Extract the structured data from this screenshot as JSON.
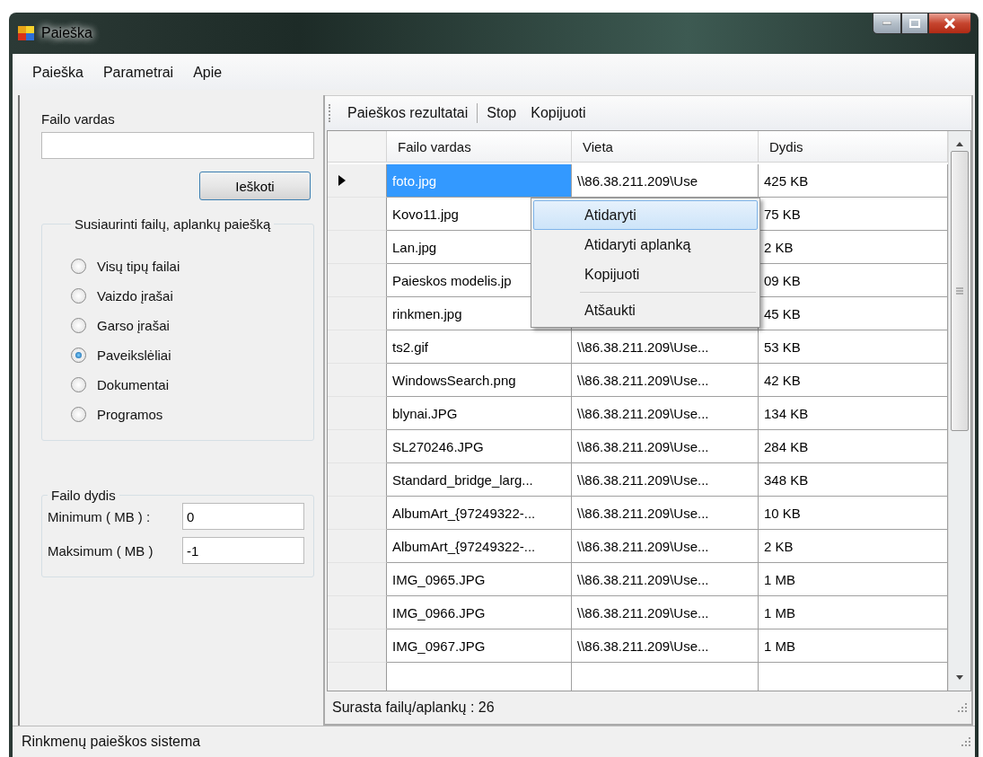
{
  "window": {
    "title": "Paieška"
  },
  "menu": [
    "Paieška",
    "Parametrai",
    "Apie"
  ],
  "search": {
    "label": "Failo vardas",
    "button": "Ieškoti"
  },
  "filter": {
    "title": "Susiaurinti failų, aplankų paiešką",
    "options": [
      {
        "label": "Visų tipų failai",
        "selected": false
      },
      {
        "label": "Vaizdo įrašai",
        "selected": false
      },
      {
        "label": "Garso įrašai",
        "selected": false
      },
      {
        "label": "Paveikslėliai",
        "selected": true
      },
      {
        "label": "Dokumentai",
        "selected": false
      },
      {
        "label": "Programos",
        "selected": false
      }
    ]
  },
  "size": {
    "title": "Failo dydis",
    "fields": [
      {
        "label": "Minimum ( MB ) :",
        "value": "0"
      },
      {
        "label": "Maksimum ( MB )",
        "value": "-1"
      }
    ]
  },
  "toolbar": [
    "Paieškos rezultatai",
    "Stop",
    "Kopijuoti"
  ],
  "table": {
    "columns": [
      "Failo vardas",
      "Vieta",
      "Dydis"
    ],
    "rows": [
      {
        "current": true,
        "selected": true,
        "cells": [
          "foto.jpg",
          "\\\\86.38.211.209\\Use",
          "425 KB"
        ]
      },
      {
        "current": false,
        "selected": false,
        "cells": [
          "Kovo11.jpg",
          "",
          "75 KB"
        ]
      },
      {
        "current": false,
        "selected": false,
        "cells": [
          "Lan.jpg",
          "",
          "2 KB"
        ]
      },
      {
        "current": false,
        "selected": false,
        "cells": [
          "Paieskos modelis.jp",
          "",
          "09 KB"
        ]
      },
      {
        "current": false,
        "selected": false,
        "cells": [
          "rinkmen.jpg",
          "",
          "45 KB"
        ]
      },
      {
        "current": false,
        "selected": false,
        "cells": [
          "ts2.gif",
          "\\\\86.38.211.209\\Use...",
          "53 KB"
        ]
      },
      {
        "current": false,
        "selected": false,
        "cells": [
          "WindowsSearch.png",
          "\\\\86.38.211.209\\Use...",
          "42 KB"
        ]
      },
      {
        "current": false,
        "selected": false,
        "cells": [
          "blynai.JPG",
          "\\\\86.38.211.209\\Use...",
          "134 KB"
        ]
      },
      {
        "current": false,
        "selected": false,
        "cells": [
          "SL270246.JPG",
          "\\\\86.38.211.209\\Use...",
          "284 KB"
        ]
      },
      {
        "current": false,
        "selected": false,
        "cells": [
          "Standard_bridge_larg...",
          "\\\\86.38.211.209\\Use...",
          "348 KB"
        ]
      },
      {
        "current": false,
        "selected": false,
        "cells": [
          "AlbumArt_{97249322-...",
          "\\\\86.38.211.209\\Use...",
          "10 KB"
        ]
      },
      {
        "current": false,
        "selected": false,
        "cells": [
          "AlbumArt_{97249322-...",
          "\\\\86.38.211.209\\Use...",
          "2 KB"
        ]
      },
      {
        "current": false,
        "selected": false,
        "cells": [
          "IMG_0965.JPG",
          "\\\\86.38.211.209\\Use...",
          "1 MB"
        ]
      },
      {
        "current": false,
        "selected": false,
        "cells": [
          "IMG_0966.JPG",
          "\\\\86.38.211.209\\Use...",
          "1 MB"
        ]
      },
      {
        "current": false,
        "selected": false,
        "cells": [
          "IMG_0967.JPG",
          "\\\\86.38.211.209\\Use...",
          "1 MB"
        ]
      }
    ]
  },
  "context_menu": [
    {
      "kind": "item",
      "label": "Atidaryti",
      "selected": true
    },
    {
      "kind": "item",
      "label": "Atidaryti aplanką",
      "selected": false
    },
    {
      "kind": "item",
      "label": "Kopijuoti",
      "selected": false
    },
    {
      "kind": "separator"
    },
    {
      "kind": "item",
      "label": "Atšaukti",
      "selected": false
    }
  ],
  "table_status": "Surasta failų/aplankų : 26",
  "status_bar": "Rinkmenų paieškos sistema"
}
